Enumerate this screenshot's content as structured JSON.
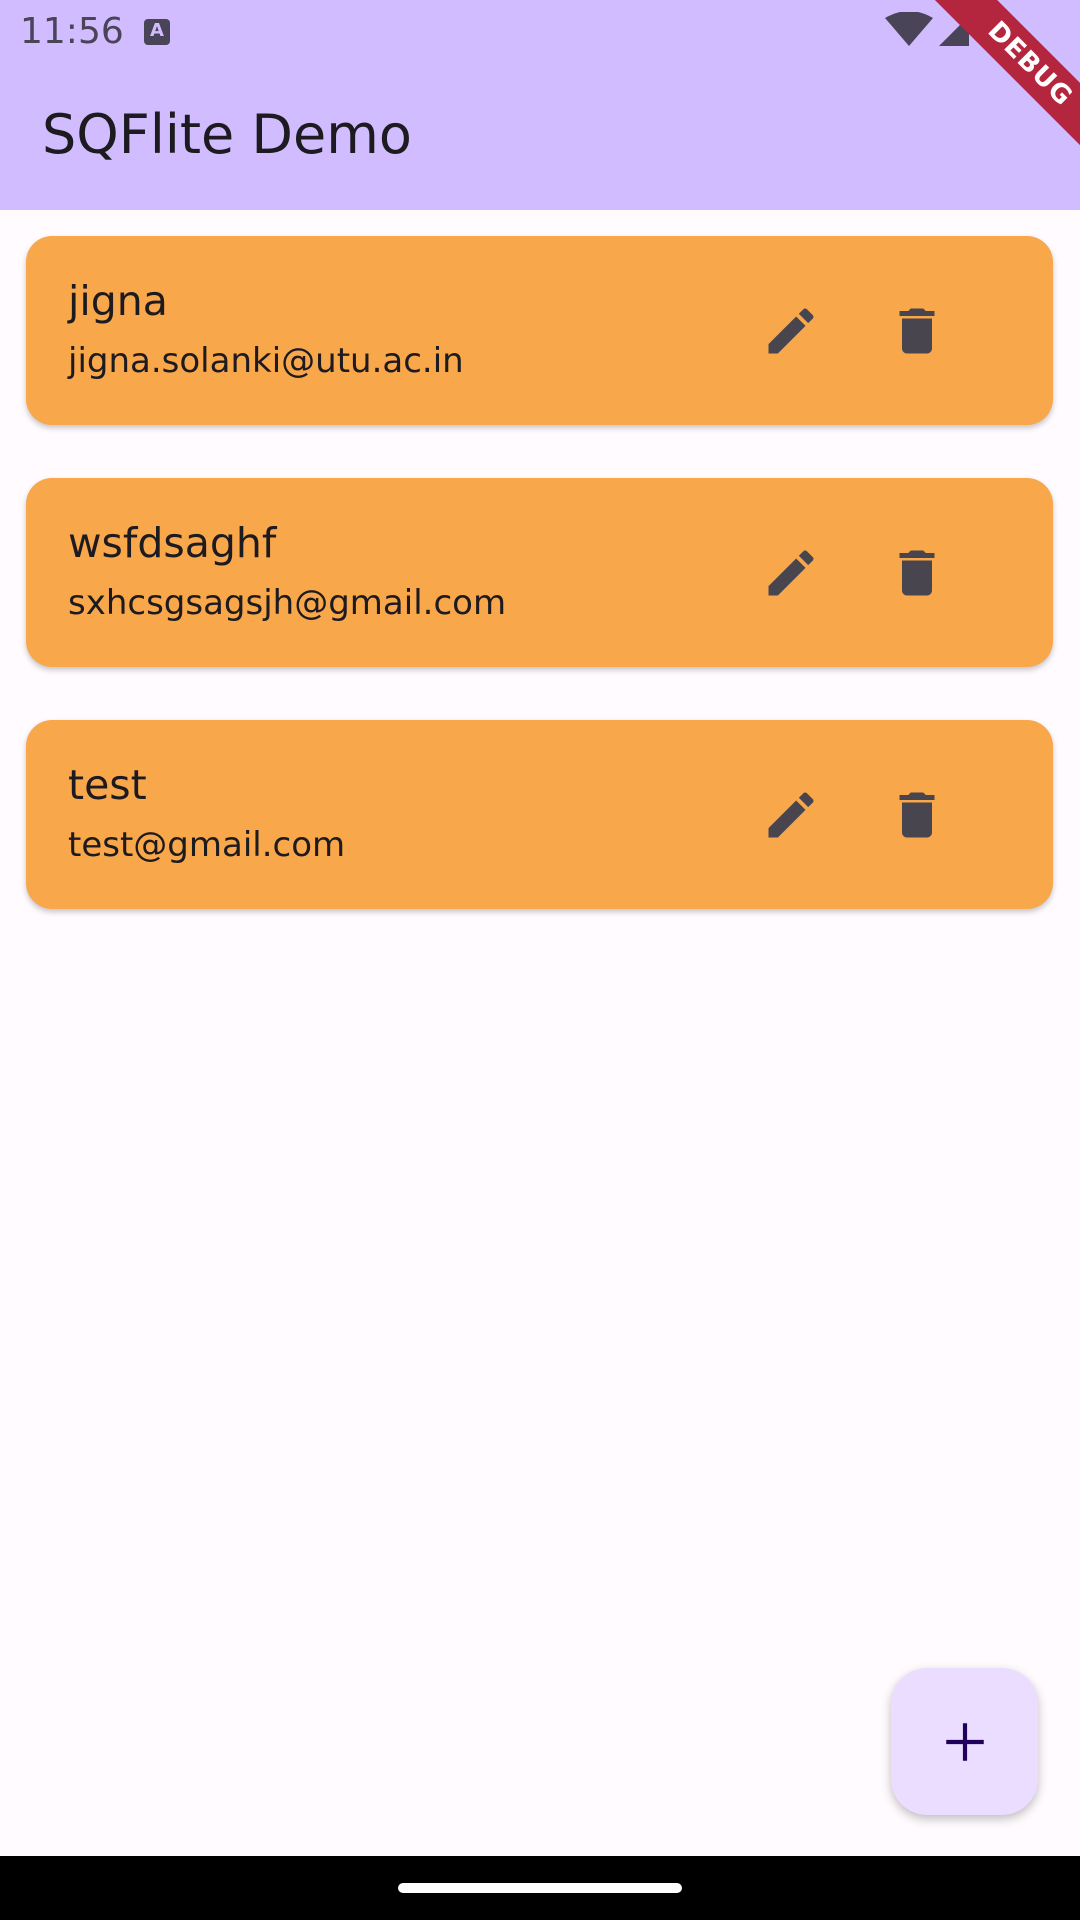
{
  "status_bar": {
    "time": "11:56",
    "notification_icon": "text-a-icon",
    "letter": "A"
  },
  "app_bar": {
    "title": "SQFlite Demo",
    "debug_banner": "DEBUG"
  },
  "contacts": [
    {
      "name": "jigna",
      "email": "jigna.solanki@utu.ac.in"
    },
    {
      "name": "wsfdsaghf",
      "email": "sxhcsgsagsjh@gmail.com"
    },
    {
      "name": "test",
      "email": "test@gmail.com"
    }
  ],
  "icons": {
    "edit": "pencil-icon",
    "delete": "trash-icon",
    "add": "plus-icon"
  },
  "colors": {
    "app_bar": "#d0bcff",
    "card": "#f9a74b",
    "fab": "#eaddff",
    "icon": "#49454f",
    "background": "#fffbfe",
    "debug": "#b3263e"
  }
}
